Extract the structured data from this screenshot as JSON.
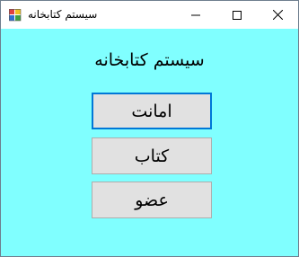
{
  "window": {
    "title": "سیستم کتابخانه",
    "background": "#80ffff",
    "controls": {
      "minimize_icon": "minimize-icon",
      "maximize_icon": "maximize-icon",
      "close_icon": "close-icon"
    }
  },
  "main": {
    "heading": "سیستم کتابخانه",
    "buttons": [
      {
        "label": "امانت",
        "focused": true
      },
      {
        "label": "کتاب",
        "focused": false
      },
      {
        "label": "عضو",
        "focused": false
      }
    ]
  },
  "colors": {
    "focus_border": "#0078d7",
    "button_face": "#e1e1e1",
    "button_border": "#adadad"
  }
}
